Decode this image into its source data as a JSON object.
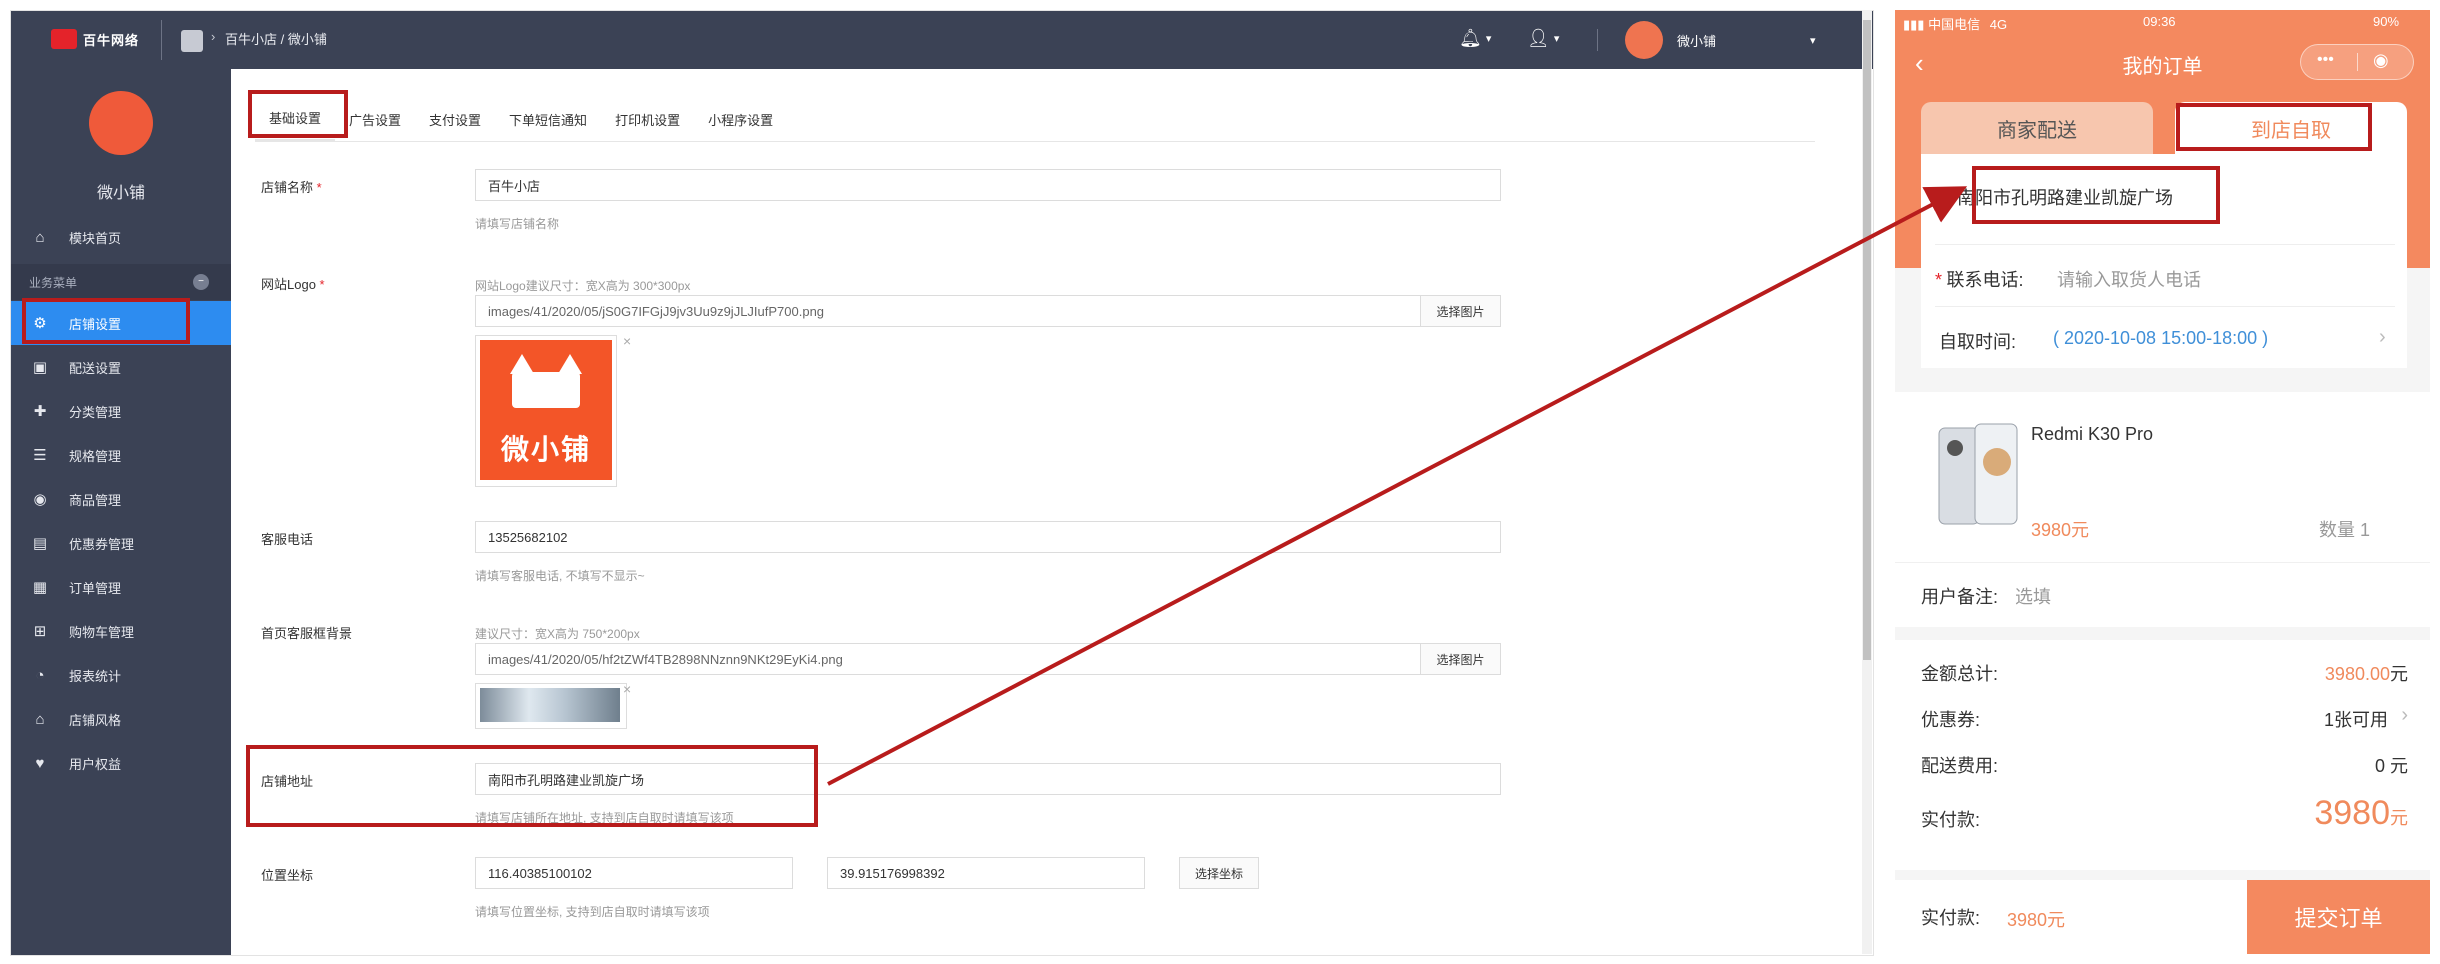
{
  "admin": {
    "topbar": {
      "logo_text": "百牛网络",
      "breadcrumb": "百牛小店 / 微小铺",
      "username": "微小铺",
      "bell_caret": "▾",
      "user_caret": "▾",
      "dropdown_caret": "▾"
    },
    "sidebar": {
      "brand_name": "微小铺",
      "section_label": "业务菜单",
      "items": [
        {
          "label": "模块首页",
          "icon": "home-icon",
          "glyph": "⌂"
        },
        {
          "label": "店铺设置",
          "icon": "gear-icon",
          "glyph": "⚙"
        },
        {
          "label": "配送设置",
          "icon": "bag-icon",
          "glyph": "▣"
        },
        {
          "label": "分类管理",
          "icon": "grid-icon",
          "glyph": "✚"
        },
        {
          "label": "规格管理",
          "icon": "list-icon",
          "glyph": "☰"
        },
        {
          "label": "商品管理",
          "icon": "goods-icon",
          "glyph": "◉"
        },
        {
          "label": "优惠券管理",
          "icon": "ticket-icon",
          "glyph": "▤"
        },
        {
          "label": "订单管理",
          "icon": "order-icon",
          "glyph": "▦"
        },
        {
          "label": "购物车管理",
          "icon": "cart-icon",
          "glyph": "⊞"
        },
        {
          "label": "报表统计",
          "icon": "chart-icon",
          "glyph": "◔"
        },
        {
          "label": "店铺风格",
          "icon": "style-icon",
          "glyph": "⌂"
        },
        {
          "label": "用户权益",
          "icon": "heart-icon",
          "glyph": "♥"
        }
      ],
      "active_index": 1
    },
    "tabs": [
      "基础设置",
      "广告设置",
      "支付设置",
      "下单短信通知",
      "打印机设置",
      "小程序设置"
    ],
    "form": {
      "shop_name": {
        "label": "店铺名称",
        "required": "*",
        "value": "百牛小店",
        "hint": "请填写店铺名称"
      },
      "site_logo": {
        "label": "网站Logo",
        "required": "*",
        "size_hint": "网站Logo建议尺寸：宽X高为 300*300px",
        "path": "images/41/2020/05/jS0G7IFGjJ9jv3Uu9z9jJLJIufP700.png",
        "button": "选择图片",
        "preview_text": "微小铺"
      },
      "service_phone": {
        "label": "客服电话",
        "value": "13525682102",
        "hint": "请填写客服电话, 不填写不显示~"
      },
      "service_bg": {
        "label": "首页客服框背景",
        "size_hint": "建议尺寸：宽X高为 750*200px",
        "path": "images/41/2020/05/hf2tZWf4TB2898NNznn9NKt29EyKi4.png",
        "button": "选择图片"
      },
      "shop_address": {
        "label": "店铺地址",
        "value": "南阳市孔明路建业凯旋广场",
        "hint": "请填写店铺所在地址, 支持到店自取时请填写该项"
      },
      "location": {
        "label": "位置坐标",
        "lng": "116.40385100102",
        "lat": "39.915176998392",
        "button": "选择坐标",
        "hint": "请填写位置坐标, 支持到店自取时请填写该项"
      }
    },
    "remove_glyph": "×"
  },
  "phone": {
    "status": {
      "carrier": "中国电信",
      "network": "4G",
      "time": "09:36",
      "battery": "90%"
    },
    "title": "我的订单",
    "back_glyph": "‹",
    "tabs": [
      "商家配送",
      "到店自取"
    ],
    "pickup": {
      "address": "南阳市孔明路建业凯旋广场",
      "phone_required": "*",
      "phone_label": "联系电话:",
      "phone_placeholder": "请输入取货人电话",
      "time_label": "自取时间:",
      "time_value": "( 2020-10-08 15:00-18:00 )",
      "arrow": "›"
    },
    "product": {
      "name": "Redmi K30 Pro",
      "price": "3980元",
      "qty": "数量 1"
    },
    "remark": {
      "label": "用户备注:",
      "placeholder": "选填"
    },
    "summary": {
      "total_label": "金额总计:",
      "total_value": "3980.00",
      "total_unit": "元",
      "coupon_label": "优惠券:",
      "coupon_value": "1张可用",
      "shipping_label": "配送费用:",
      "shipping_value": "0 元",
      "pay_label": "实付款:",
      "pay_value": "3980",
      "pay_unit": "元"
    },
    "footer": {
      "pay_label": "实付款:",
      "pay_value": "3980元",
      "submit": "提交订单"
    },
    "colors": {
      "accent": "#f4895f",
      "price": "#f08a5c",
      "link": "#3f8fd8"
    }
  },
  "annotation": {
    "color": "#b81c1c"
  }
}
